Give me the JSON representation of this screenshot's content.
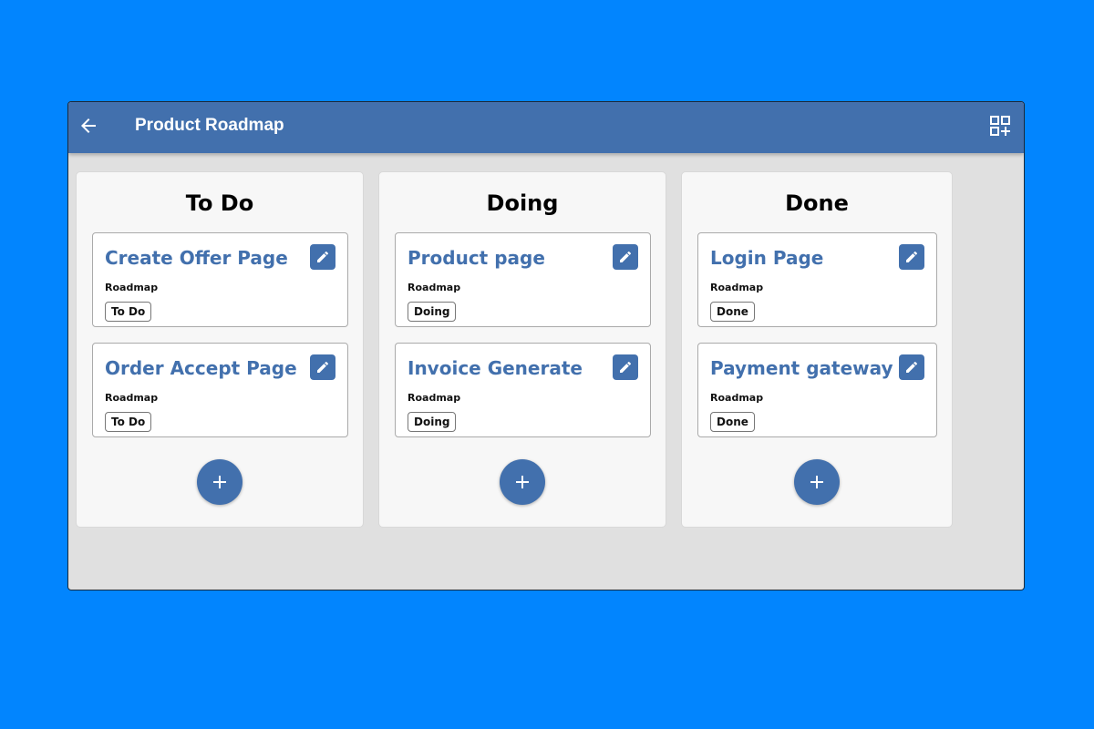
{
  "app": {
    "title": "Product Roadmap",
    "back_icon": "arrow-left-icon",
    "add_board_icon": "grid-add-icon"
  },
  "colors": {
    "background": "#0285fe",
    "app_bar": "#4270ad",
    "accent": "#4270ad",
    "board_background": "#e0e0e0",
    "column_background": "#f7f7f7"
  },
  "columns": [
    {
      "title": "To Do",
      "cards": [
        {
          "title": "Create Offer Page",
          "board": "Roadmap",
          "status": "To Do"
        },
        {
          "title": "Order Accept Page",
          "board": "Roadmap",
          "status": "To Do"
        }
      ],
      "add_icon": "plus-icon"
    },
    {
      "title": "Doing",
      "cards": [
        {
          "title": "Product page",
          "board": "Roadmap",
          "status": "Doing"
        },
        {
          "title": "Invoice Generate",
          "board": "Roadmap",
          "status": "Doing"
        }
      ],
      "add_icon": "plus-icon"
    },
    {
      "title": "Done",
      "cards": [
        {
          "title": "Login Page",
          "board": "Roadmap",
          "status": "Done"
        },
        {
          "title": "Payment gateway",
          "board": "Roadmap",
          "status": "Done"
        }
      ],
      "add_icon": "plus-icon"
    }
  ]
}
